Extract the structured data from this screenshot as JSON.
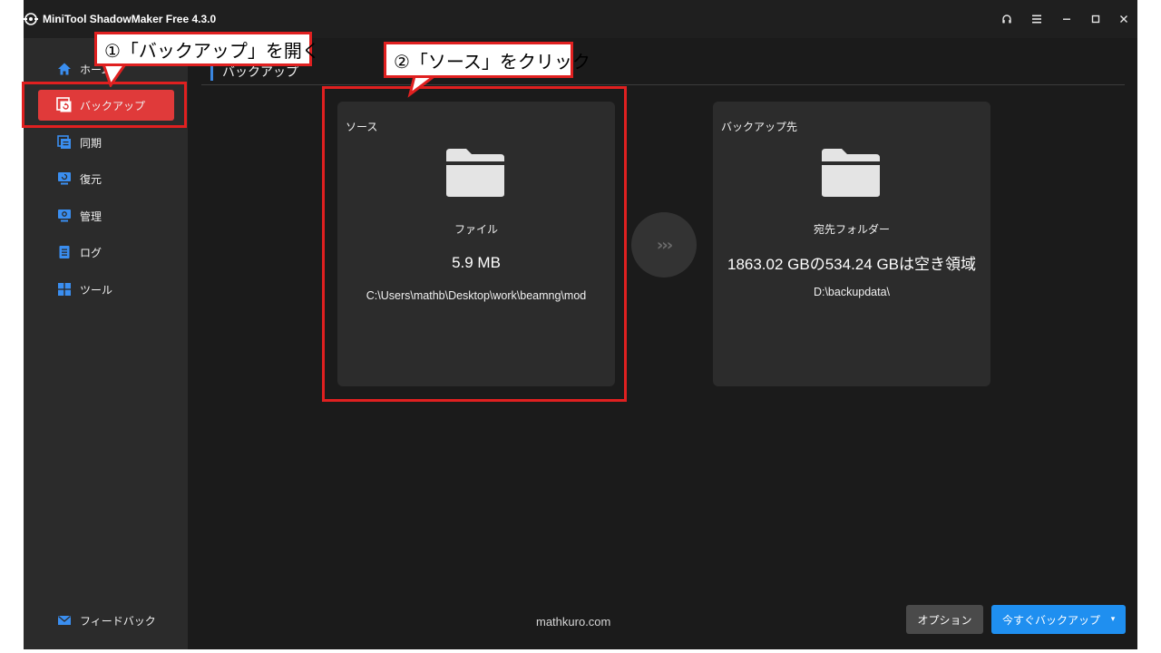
{
  "window": {
    "title": "MiniTool ShadowMaker Free 4.3.0",
    "controls": [
      "headset-icon",
      "menu-icon",
      "minimize-icon",
      "maximize-icon",
      "close-icon"
    ]
  },
  "sidebar": {
    "items": [
      {
        "label": "ホーム",
        "icon": "home-icon"
      },
      {
        "label": "バックアップ",
        "icon": "backup-icon",
        "active": true
      },
      {
        "label": "同期",
        "icon": "sync-icon"
      },
      {
        "label": "復元",
        "icon": "restore-icon"
      },
      {
        "label": "管理",
        "icon": "manage-icon"
      },
      {
        "label": "ログ",
        "icon": "log-icon"
      },
      {
        "label": "ツール",
        "icon": "tools-icon"
      }
    ],
    "feedback_label": "フィードバック"
  },
  "main": {
    "section_title": "バックアップ",
    "source": {
      "label": "ソース",
      "type": "ファイル",
      "size": "5.9 MB",
      "path": "C:\\Users\\mathb\\Desktop\\work\\beamng\\mod"
    },
    "destination": {
      "label": "バックアップ先",
      "type": "宛先フォルダー",
      "space": "1863.02 GBの534.24 GBは空き領域",
      "path": "D:\\backupdata\\"
    },
    "arrow_glyph": "›››",
    "watermark": "mathkuro.com",
    "options_label": "オプション",
    "backup_now_label": "今すぐバックアップ",
    "backup_dropdown_glyph": "▾"
  },
  "annotations": {
    "step1": "①「バックアップ」を開く",
    "step2": "②「ソース」をクリック"
  },
  "colors": {
    "accent_blue": "#1f8ff0",
    "active_red": "#e03a3a",
    "annotation_red": "#e02020",
    "sidebar_bg": "#2b2b2b",
    "main_bg": "#1b1b1b"
  }
}
